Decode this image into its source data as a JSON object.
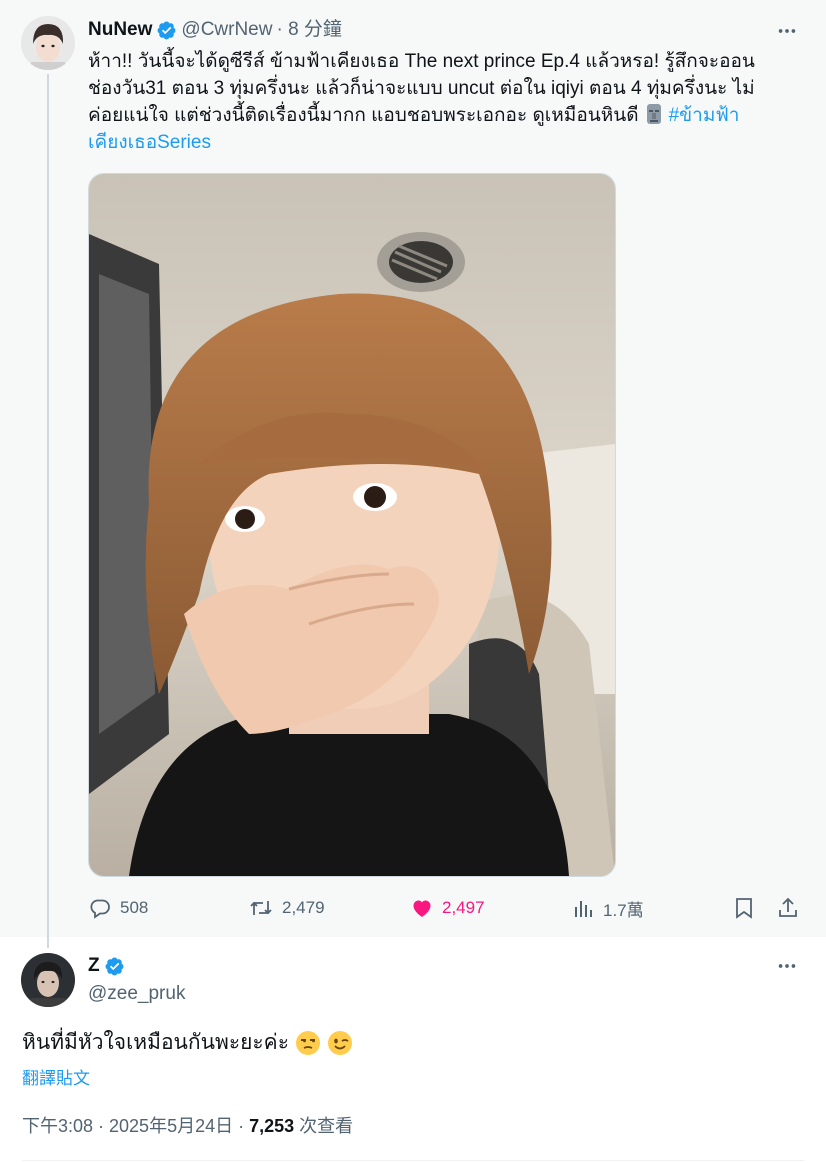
{
  "parent_tweet": {
    "display_name": "NuNew",
    "handle": "@CwrNew",
    "time_ago": "· 8 分鐘",
    "text_line1": "ห้าา!! วันนี้จะได้ดูซีรีส์ ข้ามฟ้าเคียงเธอ The next prince Ep.4 แล้วหรอ! รู้สึกจะออน",
    "text_line2": "ช่องวัน31 ตอน 3 ทุ่มครึ่งนะ แล้วก็น่าจะแบบ uncut ต่อใน iqiyi ตอน 4 ทุ่มครึ่งนะ ไม่",
    "text_line3": "ค่อยแน่ใจ แต่ช่วงนี้ติดเรื่องนี้มากก แอบชอบพระเอกอะ ดูเหมือนหินดี",
    "hashtag_part1": "#ข้ามฟ้า",
    "hashtag_part2": "เคียงเธอSeries",
    "emoji_icon": "moai-icon",
    "stats": {
      "replies": "508",
      "reposts": "2,479",
      "likes": "2,497",
      "views": "1.7萬"
    },
    "like_color": "#f91880"
  },
  "reply_tweet": {
    "display_name": "Z",
    "handle": "@zee_pruk",
    "text": "หินที่มีหัวใจเหมือนกันพะยะค่ะ",
    "emojis": [
      "unamused-face-icon",
      "winking-face-icon"
    ],
    "translate_label": "翻譯貼文",
    "time": "下午3:08 · 2025年5月24日 · ",
    "views_count": "7,253",
    "views_label": " 次查看"
  },
  "colors": {
    "accent": "#1d9bf0",
    "muted": "#536471",
    "parent_bg": "#f7f9f9"
  }
}
